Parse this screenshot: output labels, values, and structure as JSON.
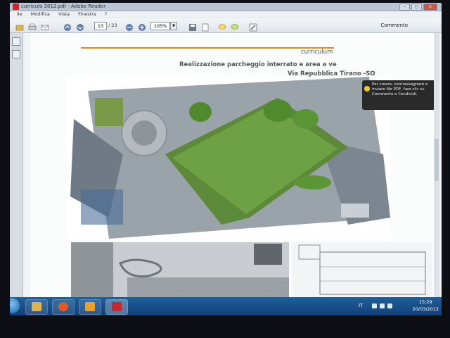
{
  "window": {
    "title": "curriculo 2012.pdf - Adobe Reader",
    "buttons": {
      "minimize": "–",
      "maximize": "□",
      "close": "x"
    }
  },
  "menu": {
    "items": [
      "ile",
      "Modifica",
      "Vista",
      "Finestra",
      "?"
    ]
  },
  "toolbar": {
    "page_current": "13",
    "page_total": "/ 23",
    "zoom": "105%",
    "comment_label": "Commento"
  },
  "document": {
    "header_label": "curriculum",
    "subtitle": "Realizzazione parcheggio interrato e area a ve",
    "location": "Via Repubblica  Tirano  -SO",
    "accent_color": "#d98b2a"
  },
  "tooltip": {
    "text": "Per creare, contrassegnare e inviare file PDF, fare clic su Commento e Condividi.",
    "icon": "lightbulb-icon"
  },
  "taskbar": {
    "apps": [
      {
        "name": "explorer",
        "icon": "folder-icon",
        "color": "#e0b24a"
      },
      {
        "name": "media-player",
        "icon": "play-icon",
        "color": "#e05a26"
      },
      {
        "name": "app-orange",
        "icon": "app-icon",
        "color": "#f0a020"
      },
      {
        "name": "adobe-reader",
        "icon": "pdf-icon",
        "color": "#c8262b"
      }
    ],
    "language": "IT",
    "time": "15:29",
    "date": "20/03/2012"
  }
}
